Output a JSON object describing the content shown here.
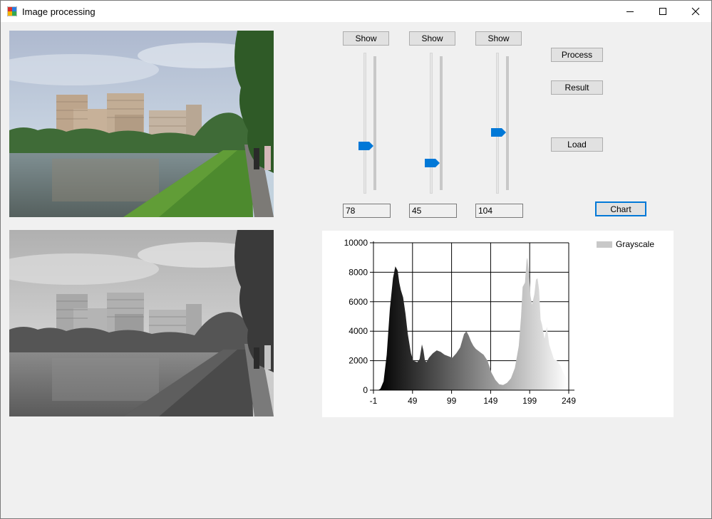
{
  "window": {
    "title": "Image processing"
  },
  "titlebar_icons": {
    "app": "app-icon",
    "minimize": "minimize-icon",
    "maximize": "maximize-icon",
    "close": "close-icon"
  },
  "buttons": {
    "show1": "Show",
    "show2": "Show",
    "show3": "Show",
    "process": "Process",
    "result": "Result",
    "load": "Load",
    "chart": "Chart"
  },
  "sliders": [
    {
      "value": 78,
      "text": "78"
    },
    {
      "value": 45,
      "text": "45"
    },
    {
      "value": 104,
      "text": "104"
    }
  ],
  "slider_range": [
    0,
    255
  ],
  "colors": {
    "accent": "#0078d7",
    "button_face": "#e1e1e1",
    "window_bg": "#f0f0f0"
  },
  "chart_data": {
    "type": "area",
    "title": "",
    "xlabel": "",
    "ylabel": "",
    "x_ticks": [
      "-1",
      "49",
      "99",
      "149",
      "199",
      "249"
    ],
    "y_ticks": [
      "0",
      "2000",
      "4000",
      "6000",
      "8000",
      "10000"
    ],
    "xlim": [
      -1,
      249
    ],
    "ylim": [
      0,
      10000
    ],
    "grid": true,
    "legend_position": "top-right",
    "series": [
      {
        "name": "Grayscale",
        "color_scale": "black-to-white",
        "x": [
          5,
          8,
          12,
          16,
          20,
          24,
          27,
          30,
          32,
          34,
          37,
          40,
          43,
          47,
          50,
          55,
          58,
          61,
          63,
          65,
          67,
          70,
          75,
          80,
          85,
          90,
          95,
          100,
          105,
          110,
          115,
          118,
          121,
          124,
          127,
          130,
          135,
          140,
          145,
          150,
          155,
          160,
          165,
          170,
          175,
          180,
          185,
          188,
          190,
          193,
          195,
          196,
          198,
          200,
          202,
          205,
          207,
          209,
          211,
          213,
          215,
          218,
          221,
          224,
          227,
          230,
          234,
          238,
          242,
          245,
          248
        ],
        "values": [
          0,
          100,
          600,
          2400,
          5500,
          7600,
          8400,
          8100,
          7300,
          6800,
          6300,
          5200,
          3800,
          2500,
          2000,
          1900,
          2100,
          3100,
          2700,
          2000,
          1900,
          2200,
          2500,
          2700,
          2600,
          2400,
          2300,
          2200,
          2500,
          2900,
          3800,
          4000,
          3700,
          3300,
          3000,
          2800,
          2600,
          2400,
          2000,
          1200,
          700,
          400,
          350,
          500,
          800,
          1500,
          3000,
          5000,
          7000,
          7300,
          8800,
          9000,
          8000,
          6400,
          5800,
          6500,
          7500,
          7600,
          6800,
          4800,
          4400,
          3500,
          4300,
          3100,
          2600,
          2100,
          2000,
          1700,
          1200,
          900,
          700
        ]
      }
    ]
  }
}
